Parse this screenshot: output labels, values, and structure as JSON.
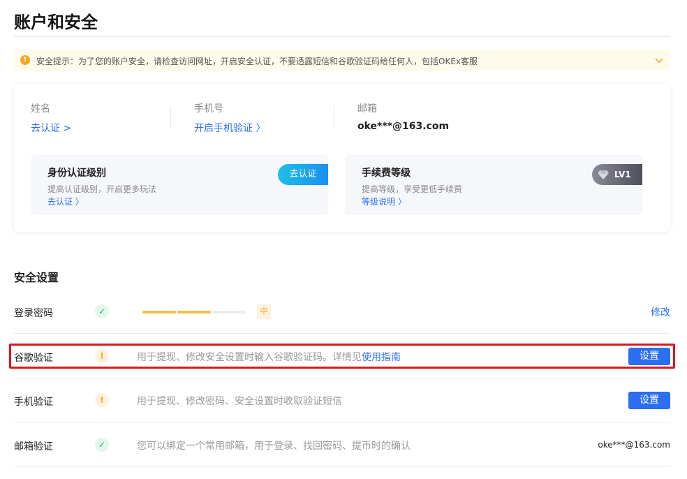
{
  "page": {
    "title": "账户和安全"
  },
  "notice": {
    "text": "安全提示：为了您的账户安全，请检查访问网址，开启安全认证，不要透露短信和谷歌验证码给任何人，包括OKEx客服",
    "icon": "warning-icon",
    "color": "#f5a623"
  },
  "profile": {
    "name": {
      "label": "姓名",
      "link": "去认证 >"
    },
    "phone": {
      "label": "手机号",
      "link": "开启手机验证 〉"
    },
    "email": {
      "label": "邮箱",
      "value": "oke***@163.com"
    }
  },
  "identity": {
    "title": "身份认证级别",
    "desc": "提高认证级别，开启更多玩法",
    "link": "去认证 〉",
    "button": "去认证"
  },
  "fee": {
    "title": "手续费等级",
    "desc": "提高等级，享受更低手续费",
    "link": "等级说明 〉",
    "level": "LV1"
  },
  "security": {
    "title": "安全设置",
    "password": {
      "label": "登录密码",
      "strength": "中",
      "strength_filled_segments": 2,
      "strength_total_segments": 3,
      "action": "修改"
    },
    "google": {
      "label": "谷歌验证",
      "desc": "用于提现、修改安全设置时输入谷歌验证码。详情见",
      "guide": "使用指南",
      "action": "设置"
    },
    "phone": {
      "label": "手机验证",
      "desc": "用于提现、修改密码、安全设置时收取验证短信",
      "action": "设置"
    },
    "email": {
      "label": "邮箱验证",
      "desc": "您可以绑定一个常用邮箱，用于登录、找回密码、提币时的确认",
      "value": "oke***@163.com"
    }
  },
  "colors": {
    "accent": "#2b6ef0",
    "warning": "#f5a623",
    "success": "#25b864",
    "highlight": "#e0161b"
  }
}
